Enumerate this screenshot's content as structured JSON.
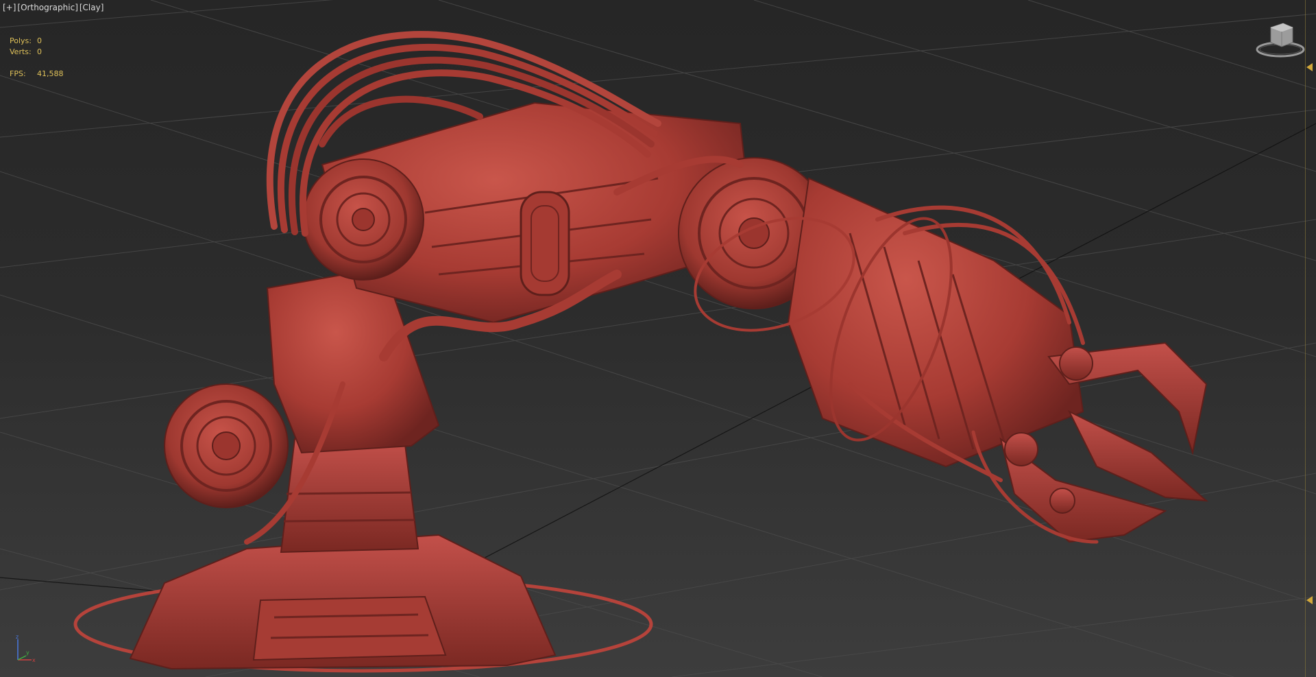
{
  "viewport": {
    "label_parts": [
      "[+]",
      "[Orthographic]",
      "[Clay]"
    ],
    "shading_color": "#b5433b",
    "background_top": "#262626",
    "background_bottom": "#3d3d3d"
  },
  "stats": {
    "polys_label": "Polys:",
    "polys_value": "0",
    "verts_label": "Verts:",
    "verts_value": "0",
    "fps_label": "FPS:",
    "fps_value": "41,588",
    "text_color": "#e0c25a"
  },
  "axis": {
    "z": "z",
    "x": "x",
    "y": "y"
  },
  "icons": {
    "viewcube": "viewcube-icon",
    "marker": "triangle-marker-icon",
    "axis": "axis-tripod-icon"
  }
}
